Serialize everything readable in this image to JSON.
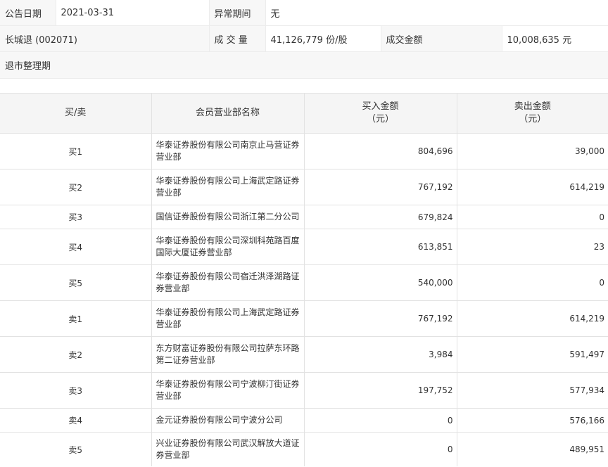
{
  "info": {
    "date_label": "公告日期",
    "date_value": "2021-03-31",
    "period_label": "异常期间",
    "period_value": "无",
    "stock": "长城退 (002071)",
    "volume_label": "成 交 量",
    "volume_value": "41,126,779 份/股",
    "amount_label": "成交金额",
    "amount_value": "10,008,635 元",
    "reason": "退市整理期"
  },
  "table": {
    "headers": {
      "side": "买/卖",
      "dept": "会员营业部名称",
      "buy_line1": "买入金额",
      "buy_line2": "（元）",
      "sell_line1": "卖出金额",
      "sell_line2": "（元）"
    },
    "rows": [
      {
        "side": "买1",
        "dept": "华泰证券股份有限公司南京止马营证券营业部",
        "buy": "804,696",
        "sell": "39,000"
      },
      {
        "side": "买2",
        "dept": "华泰证券股份有限公司上海武定路证券营业部",
        "buy": "767,192",
        "sell": "614,219"
      },
      {
        "side": "买3",
        "dept": "国信证券股份有限公司浙江第二分公司",
        "buy": "679,824",
        "sell": "0"
      },
      {
        "side": "买4",
        "dept": "华泰证券股份有限公司深圳科苑路百度国际大厦证券营业部",
        "buy": "613,851",
        "sell": "23"
      },
      {
        "side": "买5",
        "dept": "华泰证券股份有限公司宿迁洪泽湖路证券营业部",
        "buy": "540,000",
        "sell": "0"
      },
      {
        "side": "卖1",
        "dept": "华泰证券股份有限公司上海武定路证券营业部",
        "buy": "767,192",
        "sell": "614,219"
      },
      {
        "side": "卖2",
        "dept": "东方财富证券股份有限公司拉萨东环路第二证券营业部",
        "buy": "3,984",
        "sell": "591,497"
      },
      {
        "side": "卖3",
        "dept": "华泰证券股份有限公司宁波柳汀街证券营业部",
        "buy": "197,752",
        "sell": "577,934"
      },
      {
        "side": "卖4",
        "dept": "金元证券股份有限公司宁波分公司",
        "buy": "0",
        "sell": "576,166"
      },
      {
        "side": "卖5",
        "dept": "兴业证券股份有限公司武汉解放大道证券营业部",
        "buy": "0",
        "sell": "489,951"
      }
    ]
  }
}
